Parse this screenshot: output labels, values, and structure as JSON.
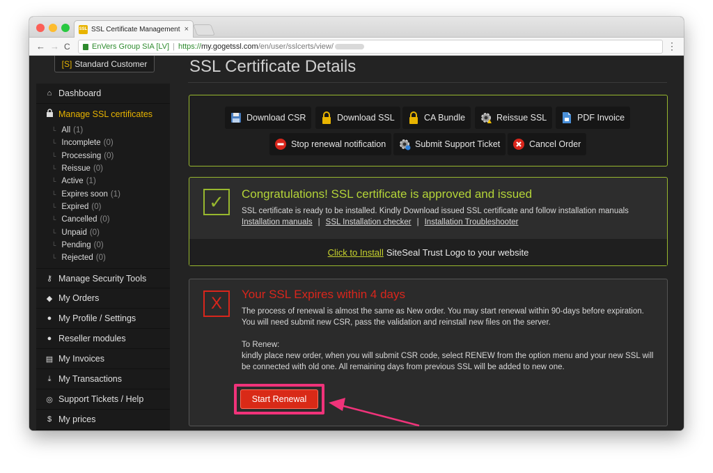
{
  "browser": {
    "tab_title": "SSL Certificate Management S",
    "tab_favicon": "SSL",
    "tab_close": "×",
    "url_org": "EnVers Group SIA [LV]",
    "url_scheme": "https://",
    "url_host": "my.gogetssl.com",
    "url_path": "/en/user/sslcerts/view/",
    "nav_back": "←",
    "nav_forward": "→",
    "nav_reload": "C",
    "menu": "⋮"
  },
  "account": {
    "badge_prefix": "[S]",
    "badge_label": "Standard Customer"
  },
  "sidebar": {
    "dashboard": "Dashboard",
    "manage_ssl": "Manage SSL certificates",
    "sub_items": [
      {
        "label": "All",
        "count": "(1)"
      },
      {
        "label": "Incomplete",
        "count": "(0)"
      },
      {
        "label": "Processing",
        "count": "(0)"
      },
      {
        "label": "Reissue",
        "count": "(0)"
      },
      {
        "label": "Active",
        "count": "(1)"
      },
      {
        "label": "Expires soon",
        "count": "(1)"
      },
      {
        "label": "Expired",
        "count": "(0)"
      },
      {
        "label": "Cancelled",
        "count": "(0)"
      },
      {
        "label": "Unpaid",
        "count": "(0)"
      },
      {
        "label": "Pending",
        "count": "(0)"
      },
      {
        "label": "Rejected",
        "count": "(0)"
      }
    ],
    "security_tools": "Manage Security Tools",
    "orders": "My Orders",
    "profile": "My Profile / Settings",
    "reseller": "Reseller modules",
    "invoices": "My Invoices",
    "transactions": "My Transactions",
    "support": "Support Tickets / Help",
    "prices": "My prices"
  },
  "main": {
    "page_title": "SSL Certificate Details",
    "actions": {
      "download_csr": "Download CSR",
      "download_ssl": "Download SSL",
      "ca_bundle": "CA Bundle",
      "reissue_ssl": "Reissue SSL",
      "pdf_invoice": "PDF Invoice",
      "stop_renewal": "Stop renewal notification",
      "submit_ticket": "Submit Support Ticket",
      "cancel_order": "Cancel Order"
    },
    "success": {
      "heading": "Congratulations! SSL certificate is approved and issued",
      "text": "SSL certificate is ready to be installed. Kindly Download issued SSL certificate and follow installation manuals",
      "link1": "Installation manuals",
      "link2": "SSL Installation checker",
      "link3": "Installation Troubleshooter",
      "separator": "|",
      "seal_link": "Click to Install",
      "seal_text": "SiteSeal Trust Logo to your website",
      "check_symbol": "✓"
    },
    "expire": {
      "x_symbol": "X",
      "heading": "Your SSL Expires within 4 days",
      "text1": "The process of renewal is almost the same as New order. You may start renewal within 90-days before expiration. You will need submit new CSR, pass the validation and reinstall new files on the server.",
      "renew_label": "To Renew:",
      "text2": "kindly place new order, when you will submit CSR code, select RENEW from the option menu and your new SSL will be connected with old one. All remaining days from previous SSL will be added to new one.",
      "button": "Start Renewal"
    }
  },
  "colors": {
    "accent_yellow": "#e8b400",
    "success_green": "#98b82e",
    "danger_red": "#d9261c",
    "highlight_pink": "#f0337a"
  }
}
